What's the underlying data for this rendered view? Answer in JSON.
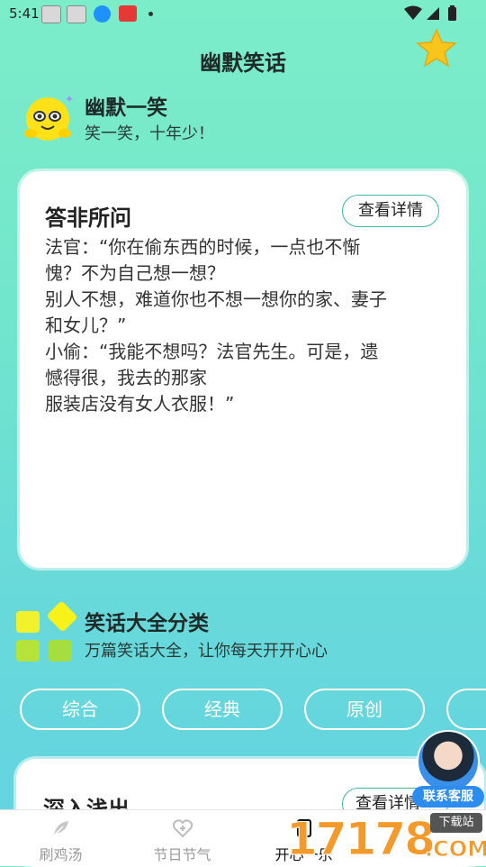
{
  "status_bar": {
    "time": "5:41"
  },
  "header": {
    "title": "幽默笑话",
    "favorite_icon": "star-icon"
  },
  "hero": {
    "title": "幽默一笑",
    "subtitle": "笑一笑，十年少！"
  },
  "joke_card": {
    "title": "答非所问",
    "detail_button": "查看详情",
    "body": "法官：“你在偷东西的时候，一点也不惭\n愧？不为自己想一想？\n别人不想，难道你也不想一想你的家、妻子\n和女儿？”\n小偷：“我能不想吗？法官先生。可是，遗\n憾得很，我去的那家\n服装店没有女人衣服！”"
  },
  "category": {
    "title": "笑话大全分类",
    "subtitle": "万篇笑话大全，让你每天开开心心",
    "chips": [
      "综合",
      "经典",
      "原创",
      ""
    ]
  },
  "second_card": {
    "title": "深入浅出",
    "detail_button": "查看详情"
  },
  "service": {
    "label": "联系客服"
  },
  "tabbar": {
    "tabs": [
      {
        "label": "刷鸡汤",
        "icon": "feather-icon"
      },
      {
        "label": "节日节气",
        "icon": "heart-plus-icon"
      },
      {
        "label": "开心一乐",
        "icon": "book-icon"
      },
      {
        "label": "",
        "icon": ""
      }
    ]
  },
  "watermark": {
    "number": "17178",
    "badge": "下载站",
    "suffix": ".COM"
  },
  "colors": {
    "accent": "#3fb9a0",
    "star": "#f7c51c",
    "watermark": "#f39a2b",
    "service": "#2d8cf0"
  }
}
